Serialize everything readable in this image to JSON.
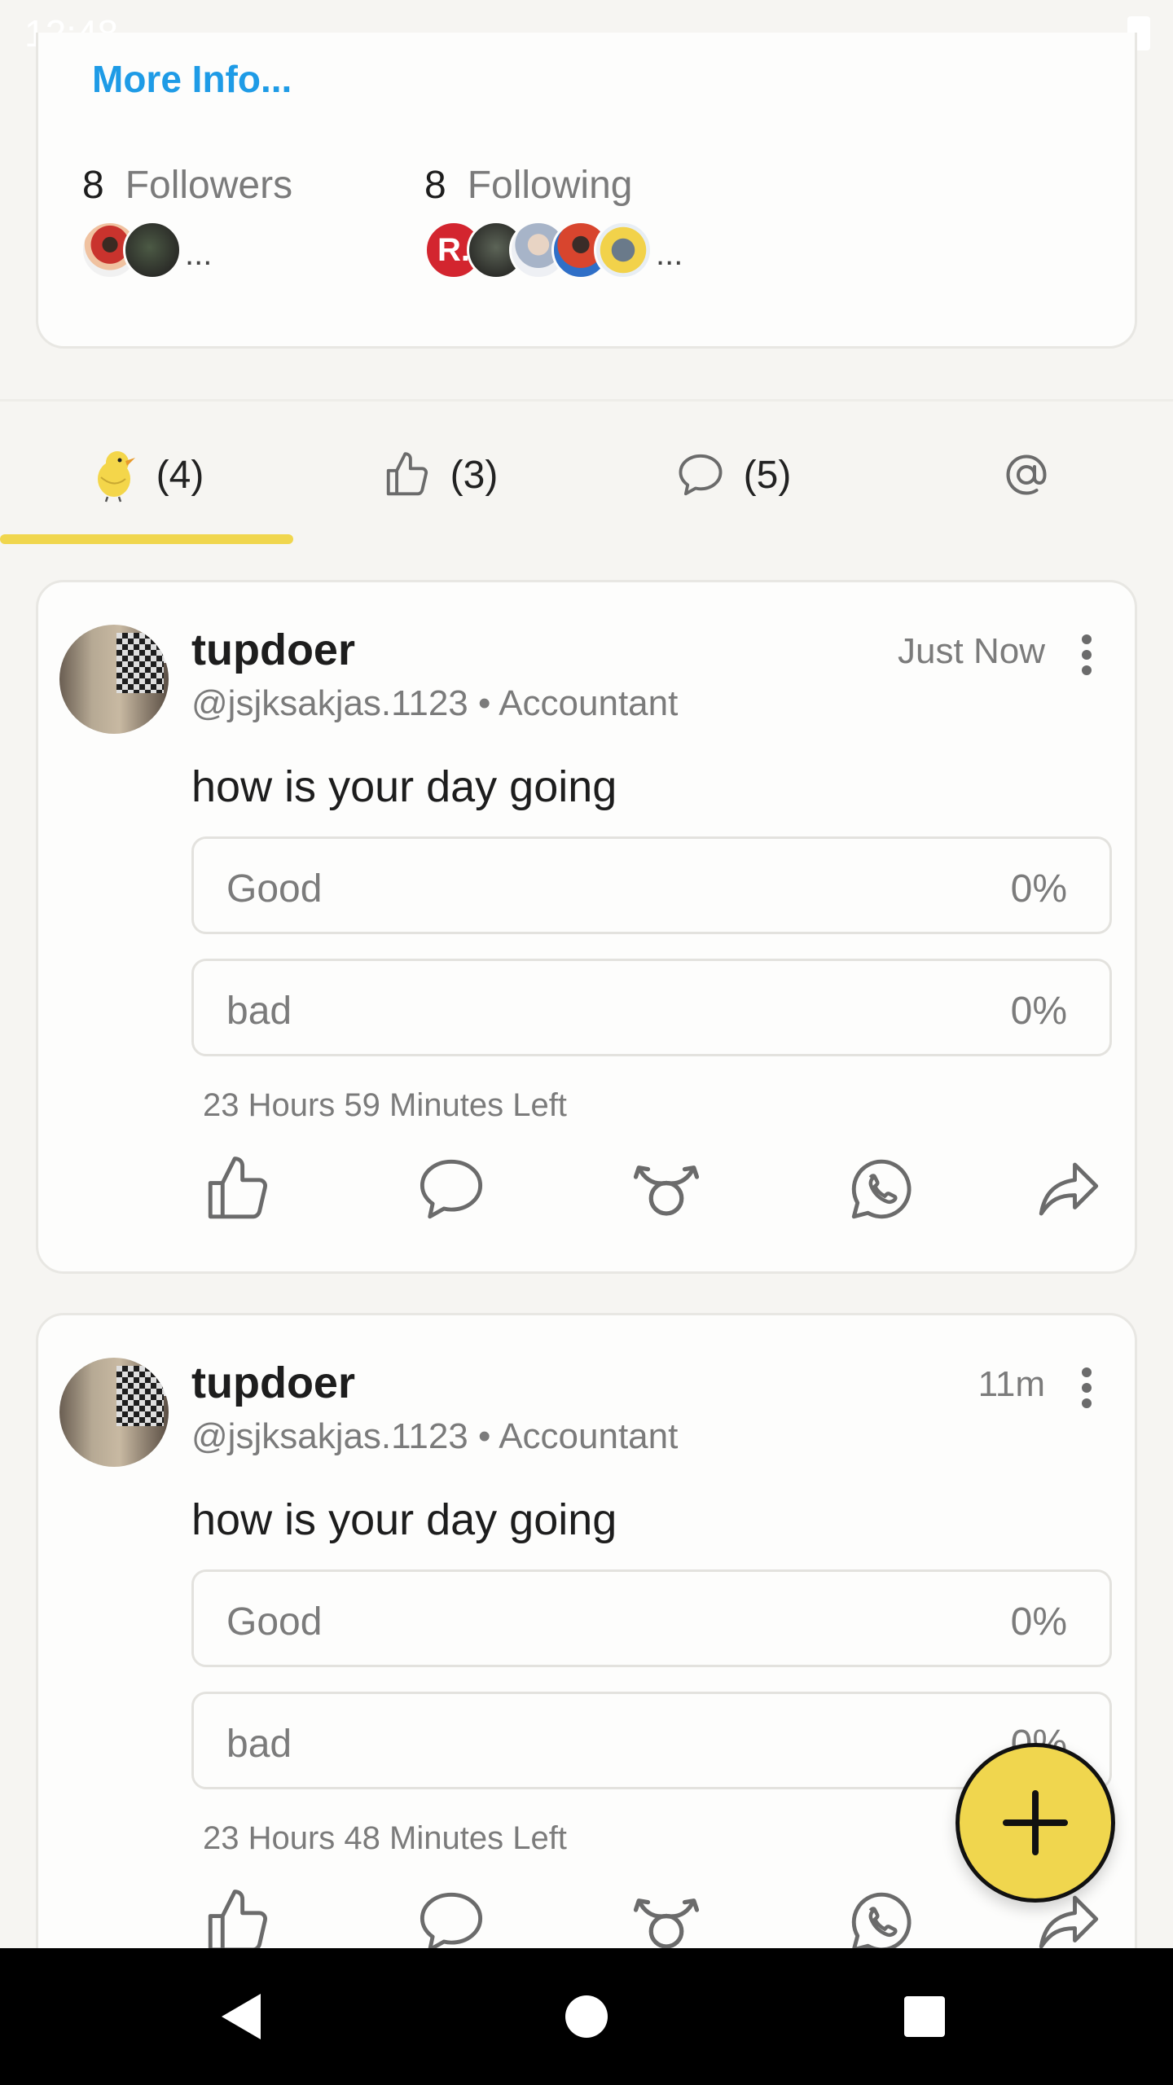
{
  "status_bar": {
    "time": "12:48"
  },
  "profile": {
    "more_info_label": "More Info...",
    "followers": {
      "count": "8",
      "label": "Followers",
      "more": "..."
    },
    "following": {
      "count": "8",
      "label": "Following",
      "more": "...",
      "first_avatar_text": "R."
    }
  },
  "tabs": [
    {
      "icon": "koo-bird-icon",
      "count": "(4)",
      "selected": true
    },
    {
      "icon": "thumbs-up-icon",
      "count": "(3)",
      "selected": false
    },
    {
      "icon": "comment-icon",
      "count": "(5)",
      "selected": false
    },
    {
      "icon": "at-mention-icon",
      "count": "",
      "selected": false
    }
  ],
  "posts": [
    {
      "username": "tupdoer",
      "handle": "@jsjksakjas.1123 • Accountant",
      "time": "Just Now",
      "question": "how is your day going",
      "options": [
        {
          "label": "Good",
          "percent": "0%"
        },
        {
          "label": "bad",
          "percent": "0%"
        }
      ],
      "time_left": "23 Hours 59 Minutes Left"
    },
    {
      "username": "tupdoer",
      "handle": "@jsjksakjas.1123 • Accountant",
      "time": "11m",
      "question": "how is your day going",
      "options": [
        {
          "label": "Good",
          "percent": "0%"
        },
        {
          "label": "bad",
          "percent": "0%"
        }
      ],
      "time_left": "23 Hours 48 Minutes Left"
    }
  ],
  "actions": [
    "like-icon",
    "comment-icon",
    "rekoo-icon",
    "whatsapp-icon",
    "share-icon"
  ],
  "colors": {
    "accent_yellow": "#f0d64e",
    "link_blue": "#1e9be6",
    "background": "#f6f5f2",
    "muted_text": "#7b7b7b"
  }
}
